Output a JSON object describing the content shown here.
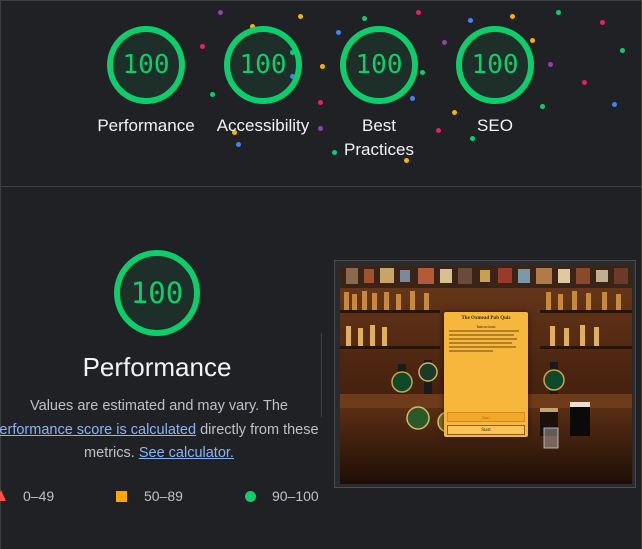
{
  "top_gauges": [
    {
      "score": "100",
      "label_line1": "Performance",
      "label_line2": ""
    },
    {
      "score": "100",
      "label_line1": "Accessibility",
      "label_line2": ""
    },
    {
      "score": "100",
      "label_line1": "Best",
      "label_line2": "Practices"
    },
    {
      "score": "100",
      "label_line1": "SEO",
      "label_line2": ""
    }
  ],
  "category": {
    "score": "100",
    "title": "Performance",
    "desc_line1": "Values are estimated and may vary. The",
    "desc_link1": "erformance score is calculated",
    "desc_mid": " directly from these",
    "desc_line3_prefix": "metrics. ",
    "desc_link2": "See calculator."
  },
  "legend": {
    "fail": "0–49",
    "average": "50–89",
    "pass": "90–100"
  },
  "screenshot_quiz": {
    "title": "The Oxmead Pub Quiz",
    "subtitle": "Instructions",
    "button1": "Start",
    "button2": "Start"
  },
  "colors": {
    "pass": "#0cce6b",
    "average": "#ffa400",
    "fail": "#ff4e42",
    "link": "#8ab4f8",
    "background": "#202124"
  }
}
